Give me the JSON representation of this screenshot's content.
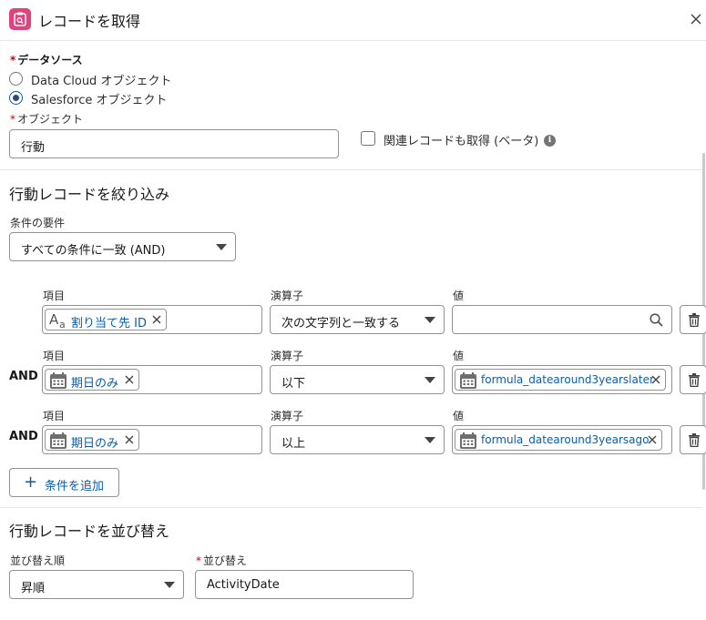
{
  "header": {
    "title": "レコードを取得",
    "icon": "record-lookup-icon",
    "icon_color": "#e3417a"
  },
  "data_source": {
    "label": "データソース",
    "options": [
      {
        "label": "Data Cloud オブジェクト",
        "checked": false
      },
      {
        "label": "Salesforce オブジェクト",
        "checked": true
      }
    ]
  },
  "object": {
    "label": "オブジェクト",
    "value": "行動"
  },
  "related_records": {
    "label": "関連レコードも取得 (ベータ)",
    "checked": false
  },
  "filter": {
    "title": "行動レコードを絞り込み",
    "condition_label": "条件の要件",
    "condition_value": "すべての条件に一致 (AND)",
    "column_labels": {
      "field": "項目",
      "operator": "演算子",
      "value": "値"
    },
    "rows": [
      {
        "prefix": "",
        "field": "割り当て先 ID",
        "field_icon": "text-type-icon",
        "operator": "次の文字列と一致する",
        "value": "",
        "value_icon": "search-icon"
      },
      {
        "prefix": "AND",
        "field": "期日のみ",
        "field_icon": "calendar-icon",
        "operator": "以下",
        "value": "formula_datearound3yearslater",
        "value_icon": "calendar-icon"
      },
      {
        "prefix": "AND",
        "field": "期日のみ",
        "field_icon": "calendar-icon",
        "operator": "以上",
        "value": "formula_datearound3yearsago",
        "value_icon": "calendar-icon"
      }
    ],
    "add_condition": "条件を追加"
  },
  "sort": {
    "title": "行動レコードを並び替え",
    "order_label": "並び替え順",
    "order_value": "昇順",
    "field_label": "並び替え",
    "field_value": "ActivityDate"
  },
  "colors": {
    "link": "#0b5cab",
    "required": "#ba0517",
    "border": "#939393"
  }
}
